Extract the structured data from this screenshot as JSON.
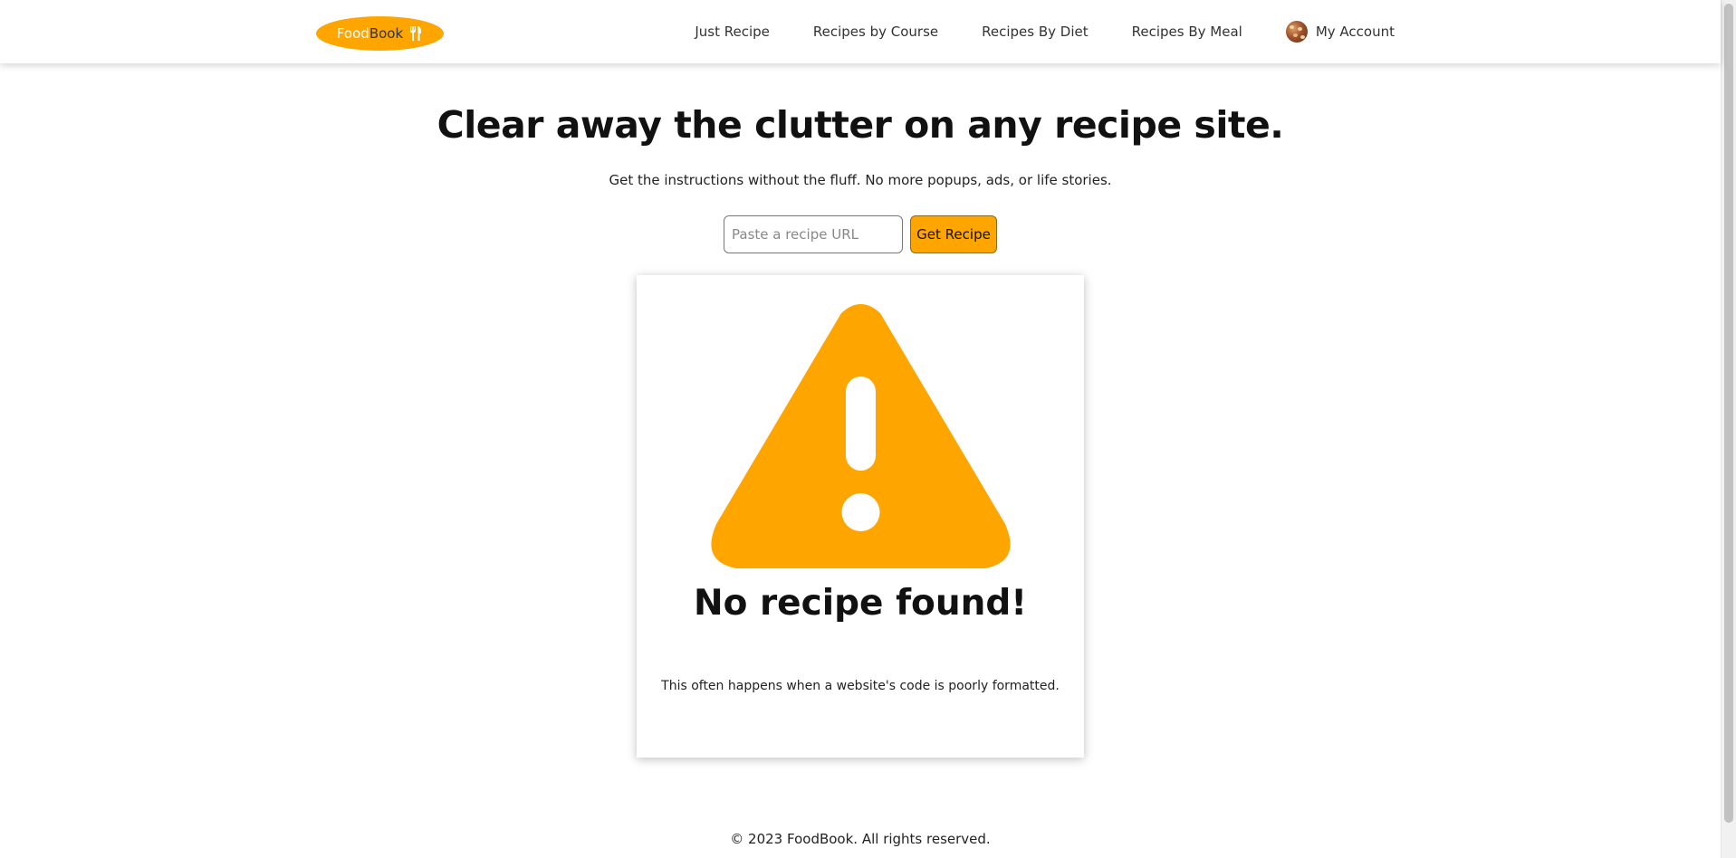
{
  "brand": {
    "part1": "Food",
    "part2": "Book",
    "accent_color": "#FFA500",
    "icon": "utensils-icon"
  },
  "nav": {
    "items": [
      {
        "label": "Just Recipe"
      },
      {
        "label": "Recipes by Course"
      },
      {
        "label": "Recipes By Diet"
      },
      {
        "label": "Recipes By Meal"
      }
    ],
    "account_label": "My Account",
    "account_icon": "avatar"
  },
  "hero": {
    "title": "Clear away the clutter on any recipe site.",
    "subtitle": "Get the instructions without the fluff. No more popups, ads, or life stories."
  },
  "search": {
    "placeholder": "Paste a recipe URL",
    "value": "",
    "button_label": "Get Recipe"
  },
  "result": {
    "icon": "warning-icon",
    "title": "No recipe found!",
    "message": "This often happens when a website's code is poorly formatted."
  },
  "footer": {
    "text": "© 2023 FoodBook. All rights reserved."
  }
}
